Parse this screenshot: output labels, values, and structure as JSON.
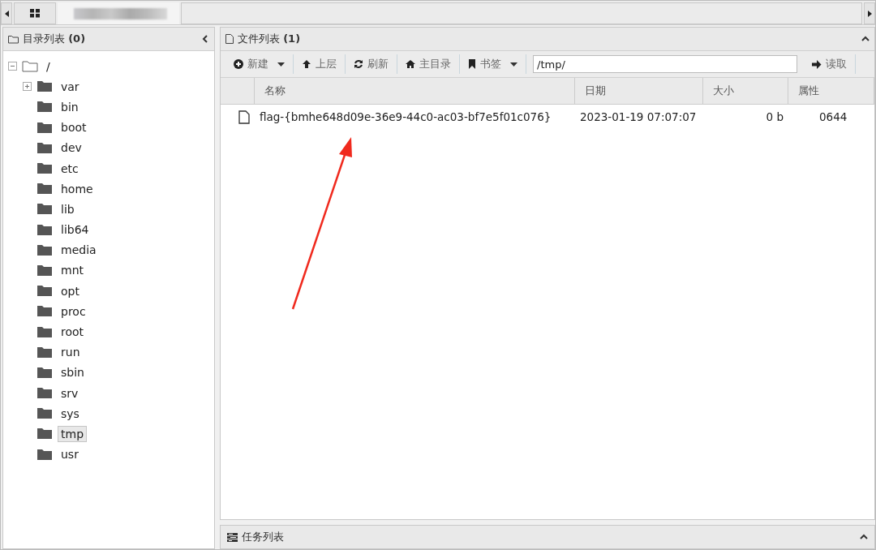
{
  "tree_panel": {
    "title": "目录列表",
    "count": "(0)",
    "root": {
      "label": "/",
      "expanded": true,
      "children": [
        {
          "label": "var",
          "has_children": true,
          "selected": false
        },
        {
          "label": "bin",
          "has_children": false,
          "selected": false
        },
        {
          "label": "boot",
          "has_children": false,
          "selected": false
        },
        {
          "label": "dev",
          "has_children": false,
          "selected": false
        },
        {
          "label": "etc",
          "has_children": false,
          "selected": false
        },
        {
          "label": "home",
          "has_children": false,
          "selected": false
        },
        {
          "label": "lib",
          "has_children": false,
          "selected": false
        },
        {
          "label": "lib64",
          "has_children": false,
          "selected": false
        },
        {
          "label": "media",
          "has_children": false,
          "selected": false
        },
        {
          "label": "mnt",
          "has_children": false,
          "selected": false
        },
        {
          "label": "opt",
          "has_children": false,
          "selected": false
        },
        {
          "label": "proc",
          "has_children": false,
          "selected": false
        },
        {
          "label": "root",
          "has_children": false,
          "selected": false
        },
        {
          "label": "run",
          "has_children": false,
          "selected": false
        },
        {
          "label": "sbin",
          "has_children": false,
          "selected": false
        },
        {
          "label": "srv",
          "has_children": false,
          "selected": false
        },
        {
          "label": "sys",
          "has_children": false,
          "selected": false
        },
        {
          "label": "tmp",
          "has_children": false,
          "selected": true
        },
        {
          "label": "usr",
          "has_children": false,
          "selected": false
        }
      ]
    }
  },
  "file_panel": {
    "title": "文件列表",
    "count": "(1)",
    "toolbar": [
      {
        "kind": "new",
        "label": "新建",
        "dropdown": true
      },
      {
        "kind": "up",
        "label": "上层",
        "dropdown": false
      },
      {
        "kind": "refresh",
        "label": "刷新",
        "dropdown": false
      },
      {
        "kind": "home",
        "label": "主目录",
        "dropdown": false
      },
      {
        "kind": "bookmark",
        "label": "书签",
        "dropdown": true
      }
    ],
    "path": "/tmp/",
    "read_button": "读取",
    "columns": [
      "名称",
      "日期",
      "大小",
      "属性"
    ],
    "rows": [
      {
        "name": "flag-{bmhe648d09e-36e9-44c0-ac03-bf7e5f01c076}",
        "date": "2023-01-19 07:07:07",
        "size": "0 b",
        "mode": "0644"
      }
    ]
  },
  "task_panel": {
    "title": "任务列表"
  }
}
